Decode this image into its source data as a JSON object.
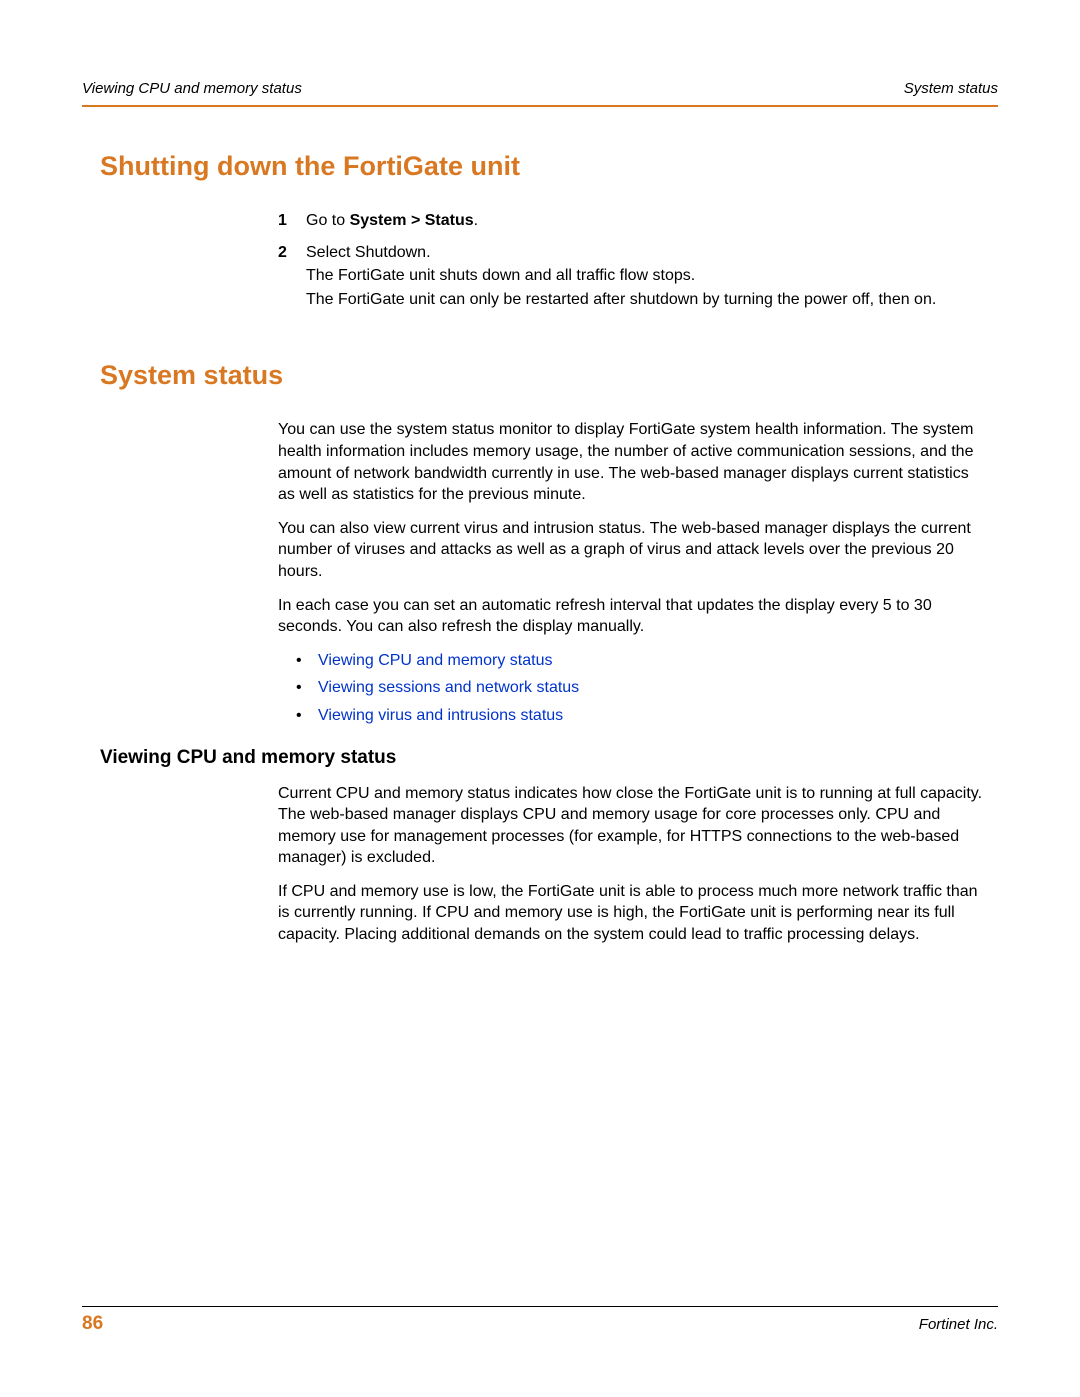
{
  "header": {
    "left": "Viewing CPU and memory status",
    "right": "System status"
  },
  "section1": {
    "title": "Shutting down the FortiGate unit",
    "step1": {
      "num": "1",
      "prefix": "Go to ",
      "bold": "System > Status",
      "suffix": "."
    },
    "step2": {
      "num": "2",
      "line1": "Select Shutdown.",
      "line2": "The FortiGate unit shuts down and all traffic flow stops.",
      "line3": "The FortiGate unit can only be restarted after shutdown by turning the power off, then on."
    }
  },
  "section2": {
    "title": "System status",
    "para1": "You can use the system status monitor to display FortiGate system health information. The system health information includes memory usage, the number of active communication sessions, and the amount of network bandwidth currently in use. The web-based manager displays current statistics as well as statistics for the previous minute.",
    "para2": "You can also view current virus and intrusion status. The web-based manager displays the current number of viruses and attacks as well as a graph of virus and attack levels over the previous 20 hours.",
    "para3": "In each case you can set an automatic refresh interval that updates the display every 5 to 30 seconds. You can also refresh the display manually.",
    "bullets": [
      "Viewing CPU and memory status",
      "Viewing sessions and network status",
      "Viewing virus and intrusions status"
    ],
    "sub1": {
      "title": "Viewing CPU and memory status",
      "para1": "Current CPU and memory status indicates how close the FortiGate unit is to running at full capacity. The web-based manager displays CPU and memory usage for core processes only. CPU and memory use for management processes (for example, for HTTPS connections to the web-based manager) is excluded.",
      "para2": "If CPU and memory use is low, the FortiGate unit is able to process much more network traffic than is currently running. If CPU and memory use is high, the FortiGate unit is performing near its full capacity. Placing additional demands on the system could lead to traffic processing delays."
    }
  },
  "footer": {
    "page": "86",
    "company": "Fortinet Inc."
  },
  "glyphs": {
    "bullet": "•"
  }
}
